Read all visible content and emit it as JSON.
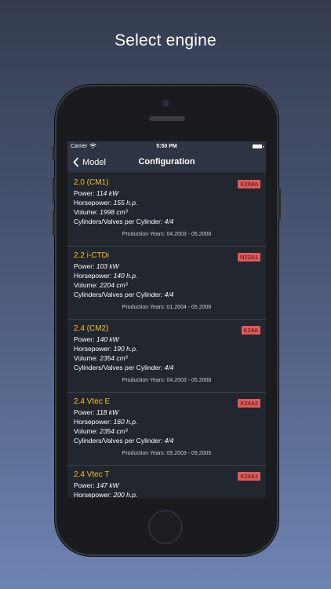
{
  "headline": "Select engine",
  "status": {
    "carrier": "Carrier",
    "time": "5:50 PM"
  },
  "nav": {
    "back_label": "Model",
    "title": "Configuration"
  },
  "labels": {
    "power": "Power:",
    "horsepower": "Horsepower:",
    "volume": "Volume:",
    "cylinders": "Cylinders/Valves per Cylinder:",
    "production": "Production Years:"
  },
  "engines": [
    {
      "name": "2.0 (CM1)",
      "code": "K20A6",
      "power": "114 kW",
      "horsepower": "155 h.p.",
      "volume": "1998 cm³",
      "cylinders": "4/4",
      "years": "04.2003 - 05.2008"
    },
    {
      "name": "2.2 i-CTDi",
      "code": "N22A1",
      "power": "103 kW",
      "horsepower": "140 h.p.",
      "volume": "2204 cm³",
      "cylinders": "4/4",
      "years": "01.2004 - 05.2008"
    },
    {
      "name": "2.4 (CM2)",
      "code": "K24A",
      "power": "140 kW",
      "horsepower": "190 h.p.",
      "volume": "2354 cm³",
      "cylinders": "4/4",
      "years": "04.2003 - 05.2008"
    },
    {
      "name": "2.4 Vtec E",
      "code": "K24A2",
      "power": "118 kW",
      "horsepower": "160 h.p.",
      "volume": "2354 cm³",
      "cylinders": "4/4",
      "years": "09.2003 - 09.2005"
    },
    {
      "name": "2.4 Vtec T",
      "code": "K24A1",
      "power": "147 kW",
      "horsepower": "200 h.p.",
      "volume": "",
      "cylinders": "",
      "years": ""
    }
  ]
}
